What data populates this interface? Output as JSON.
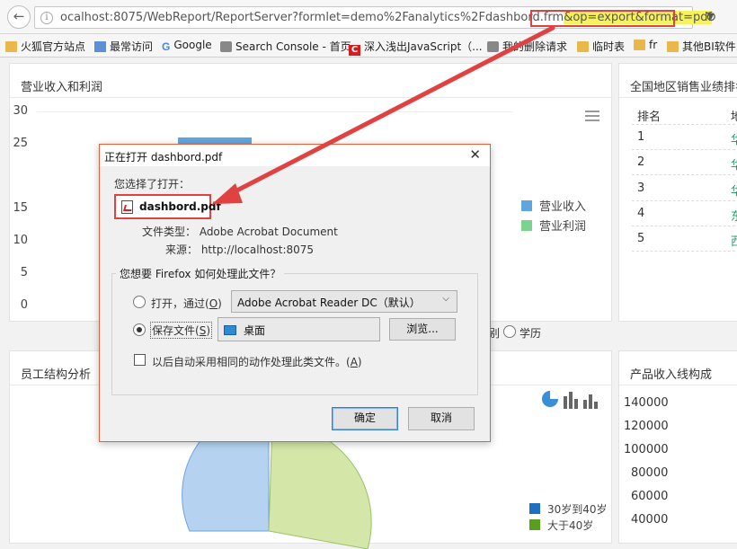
{
  "browser": {
    "url_prefix": "ocalhost:8075/WebReport/ReportServer?formlet=demo%2Fanalytics%2Fdashbord.frm",
    "url_highlight": "&op=export&format=pdf",
    "bookmarks": [
      "火狐官方站点",
      "最常访问",
      "Google",
      "Search Console - 首页",
      "深入浅出JavaScript（...",
      "我的删除请求",
      "临时表",
      "fr",
      "其他BI软件"
    ]
  },
  "revenue_panel": {
    "title": "营业收入和利润",
    "legend": [
      "营业收入",
      "营业利润"
    ],
    "y_ticks": [
      "30",
      "25",
      "15",
      "10",
      "5",
      "0"
    ]
  },
  "chart_data": {
    "type": "bar",
    "title": "营业收入和利润",
    "ylim": [
      0,
      30
    ],
    "series": [
      {
        "name": "营业收入",
        "values": [
          26
        ]
      },
      {
        "name": "营业利润",
        "values": []
      }
    ]
  },
  "ranking_panel": {
    "title": "全国地区销售业绩排名",
    "header": "排名",
    "header2": "地",
    "ranks": [
      "1",
      "2",
      "3",
      "4",
      "5"
    ],
    "cells": [
      "华",
      "华",
      "华",
      "东",
      "西"
    ]
  },
  "filter": {
    "partial": "别",
    "option": "学历"
  },
  "staff_panel": {
    "title": "员工结构分析",
    "legend": [
      "30岁到40岁",
      "大于40岁"
    ]
  },
  "product_panel": {
    "title": "产品收入线构成",
    "y_ticks": [
      "140000",
      "120000",
      "100000",
      "80000",
      "60000",
      "40000"
    ]
  },
  "dialog": {
    "title": "正在打开 dashbord.pdf",
    "chosen_label": "您选择了打开：",
    "file_name": "dashbord.pdf",
    "file_type": "文件类型： Adobe Acrobat Document",
    "source": "来源： http://localhost:8075",
    "question": "您想要 Firefox 如何处理此文件？",
    "open_with_label": "打开，通过(",
    "open_with_key": "O",
    "open_with_app": "Adobe Acrobat Reader DC（默认）",
    "save_label": "保存文件(",
    "save_key": "S",
    "save_target": "桌面",
    "browse_label": "浏览...",
    "auto_label": "以后自动采用相同的动作处理此类文件。(",
    "auto_key": "A",
    "ok_label": "确定",
    "cancel_label": "取消"
  },
  "colors": {
    "bar_blue": "#5fa6df",
    "legend_green": "#7bd48e",
    "arrow_red": "#e04242",
    "url_highlight": "#f5f25a"
  }
}
